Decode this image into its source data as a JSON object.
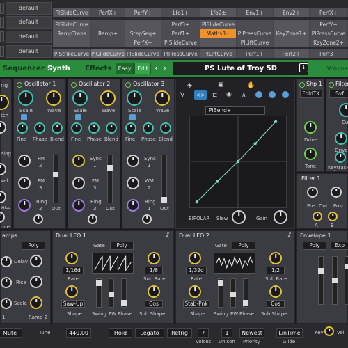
{
  "matrix": {
    "slots": [
      "default",
      "default",
      "default",
      "default"
    ],
    "cells": [
      {
        "r": 0,
        "c": 0,
        "t": "PlSlideCurve"
      },
      {
        "r": 0,
        "c": 1,
        "t": "PerfX+"
      },
      {
        "r": 0,
        "c": 2,
        "t": "PerfY+"
      },
      {
        "r": 0,
        "c": 3,
        "t": "Lfo1+"
      },
      {
        "r": 0,
        "c": 4,
        "t": "Lfo2±"
      },
      {
        "r": 0,
        "c": 5,
        "t": "Env1+"
      },
      {
        "r": 0,
        "c": 6,
        "t": "Env2+"
      },
      {
        "r": 0,
        "c": 7,
        "t": "PerfX+"
      },
      {
        "r": 1,
        "c": 0,
        "t": "PlSlideCurve"
      },
      {
        "r": 1,
        "c": 1,
        "t": ""
      },
      {
        "r": 1,
        "c": 2,
        "t": ""
      },
      {
        "r": 1,
        "c": 3,
        "t": "Perf3+"
      },
      {
        "r": 1,
        "c": 4,
        "t": "PlSlideCurve"
      },
      {
        "r": 1,
        "c": 5,
        "t": ""
      },
      {
        "r": 1,
        "c": 6,
        "t": ""
      },
      {
        "r": 1,
        "c": 7,
        "t": "PerfY+"
      },
      {
        "r": 2,
        "c": 0,
        "t": "RampTrans"
      },
      {
        "r": 2,
        "c": 1,
        "t": "Ramp+"
      },
      {
        "r": 2,
        "c": 2,
        "t": "StepSeq+"
      },
      {
        "r": 2,
        "c": 3,
        "t": "Perf1+"
      },
      {
        "r": 2,
        "c": 4,
        "t": "Maths3±"
      },
      {
        "r": 2,
        "c": 5,
        "t": "PlPressCurve"
      },
      {
        "r": 2,
        "c": 6,
        "t": "KeyZone1+"
      },
      {
        "r": 2,
        "c": 7,
        "t": "PlPressCurve"
      },
      {
        "r": 3,
        "c": 0,
        "t": ""
      },
      {
        "r": 3,
        "c": 1,
        "t": ""
      },
      {
        "r": 3,
        "c": 2,
        "t": "PerfX+"
      },
      {
        "r": 3,
        "c": 3,
        "t": "PlSlideCurve"
      },
      {
        "r": 3,
        "c": 4,
        "t": ""
      },
      {
        "r": 3,
        "c": 5,
        "t": "PlLiftCurve"
      },
      {
        "r": 3,
        "c": 6,
        "t": ""
      },
      {
        "r": 3,
        "c": 7,
        "t": "KeyZone2+"
      },
      {
        "r": 4,
        "c": 0,
        "t": "PlStrikeCurve"
      },
      {
        "r": 4,
        "c": 1,
        "t": "PlGlideCurve"
      },
      {
        "r": 4,
        "c": 2,
        "t": "PlSlideCurve"
      },
      {
        "r": 4,
        "c": 3,
        "t": "PlPressCurve"
      },
      {
        "r": 4,
        "c": 4,
        "t": "PlLiftCurve"
      },
      {
        "r": 4,
        "c": 5,
        "t": "Perf1+"
      },
      {
        "r": 4,
        "c": 6,
        "t": "Perf2+"
      },
      {
        "r": 4,
        "c": 7,
        "t": "Perf3+"
      }
    ]
  },
  "toolbar": {
    "sequencer": "Sequencer",
    "synth": "Synth",
    "effects": "Effects",
    "easy": "Easy",
    "edit": "Edit",
    "prev": "‹",
    "next": "›",
    "preset": "PS Lute of Troy 5D",
    "volume": "Volume"
  },
  "panels": {
    "osc1": {
      "title": "Oscillator 1",
      "scale": "Scale",
      "wave": "Wave",
      "fine": "Fine",
      "phase": "Phase",
      "blend": "Blend",
      "fm2": "FM",
      "fm3": "FM",
      "n2": "2",
      "n3": "3",
      "ring": "Ring",
      "ringn": "2",
      "out": "Out"
    },
    "osc2": {
      "title": "Oscillator 2",
      "scale": "Scale",
      "wave": "Wave",
      "fine": "Fine",
      "phase": "Phase",
      "blend": "Blend",
      "sync": "Sync",
      "syncn": "1",
      "fm": "FM",
      "fmn": "3",
      "ring": "Ring",
      "ringn": "3",
      "out": "Out"
    },
    "osc3": {
      "title": "Oscillator 3",
      "scale": "Scale",
      "wave": "Wave",
      "fine": "Fine",
      "phase": "Phase",
      "blend": "Blend",
      "sync": "Sync",
      "syncn": "1",
      "wm": "WM",
      "wmn": "2",
      "ring": "Ring",
      "ringn": "1",
      "out": "Out"
    },
    "left": {
      "title": "ng",
      "tch": "tch",
      "alog": "alog",
      "vel": "vel",
      "hiss": "Hiss",
      "one": "one"
    },
    "shp": {
      "title": "Shp 1",
      "mode": "FoldTK",
      "drive": "Drive",
      "tone": "Tone"
    },
    "filter": {
      "title": "Filter",
      "mode": "Svf",
      "cu": "Cu",
      "drive": "Drive",
      "keytrack": "Keytrack"
    },
    "filter1": {
      "title": "Filter 1",
      "pre": "Pre",
      "out": "Out",
      "post": "Post",
      "a": "A",
      "b": "B"
    },
    "modview": {
      "param": "PlBend+",
      "bipolar": "BIPOLAR",
      "slew": "Slew",
      "gain": "Gain"
    },
    "ramps": {
      "title": "amps",
      "mode": "Poly",
      "delay": "Delay",
      "rise": "Rise",
      "scale": "Scale",
      "r1": "1",
      "r2": "Ramp 2"
    },
    "lfo1": {
      "title": "Dual LFO 1",
      "gate": "Gate",
      "mode": "Poly",
      "rate": "1/16d",
      "ratel": "Rate",
      "subrate": "1/8",
      "subratel": "Sub Rate",
      "shape": "Saw-Up",
      "shapel": "Shape",
      "swing": "Swing",
      "pw": "PW",
      "phase": "Phase",
      "subshape": "Cos",
      "subshapel": "Sub Shape"
    },
    "lfo2": {
      "title": "Dual LFO 2",
      "gate": "Gate",
      "mode": "Poly",
      "rate": "1/32d",
      "ratel": "Rate",
      "subrate": "1/2",
      "subratel": "Sub Rate",
      "shape": "Stab-Pnk",
      "shapel": "Shape",
      "swing": "Swing",
      "pw": "PW",
      "phase": "Phase",
      "subshape": "Cos",
      "subshapel": "Sub Shape"
    },
    "env1": {
      "title": "Envelope 1",
      "mode": "Poly",
      "exp": "Exp"
    }
  },
  "bottom": {
    "mute": "Mute",
    "tune": "Tune",
    "tunev": "440.00",
    "hold": "Hold",
    "legato": "Legato",
    "retrig": "Retrig",
    "voices": "7",
    "voicesl": "Voices",
    "unison": "1",
    "unisonl": "Unison",
    "priority": "Newest",
    "priorityl": "Priority",
    "glide": "LinTime",
    "glidel": "Glide",
    "key": "Key",
    "vel": "Vel"
  },
  "colors": {
    "accent": "#2b8c3e",
    "teal": "#45c0b0",
    "yellow": "#e0c23a",
    "orange": "#f0922a"
  }
}
